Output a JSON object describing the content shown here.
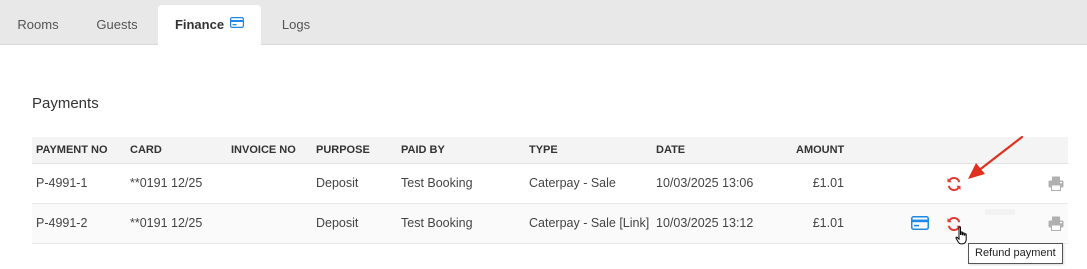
{
  "tabs": [
    {
      "label": "Rooms"
    },
    {
      "label": "Guests"
    },
    {
      "label": "Finance",
      "icon": "credit-card-icon",
      "active": true
    },
    {
      "label": "Logs"
    }
  ],
  "section": {
    "title": "Payments"
  },
  "table": {
    "headers": [
      "PAYMENT NO",
      "CARD",
      "INVOICE NO",
      "PURPOSE",
      "PAID BY",
      "TYPE",
      "DATE",
      "AMOUNT"
    ],
    "rows": [
      {
        "payment_no": "P-4991-1",
        "card": "**0191 12/25",
        "invoice_no": "",
        "purpose": "Deposit",
        "paid_by": "Test Booking",
        "type": "Caterpay - Sale",
        "date": "10/03/2025 13:06",
        "amount": "£1.01",
        "actions": [
          "refresh-icon",
          "print-icon"
        ]
      },
      {
        "payment_no": "P-4991-2",
        "card": "**0191 12/25",
        "invoice_no": "",
        "purpose": "Deposit",
        "paid_by": "Test Booking",
        "type": "Caterpay - Sale [Link]",
        "date": "10/03/2025 13:12",
        "amount": "£1.01",
        "actions": [
          "credit-card-icon",
          "refresh-icon",
          "print-icon"
        ]
      }
    ]
  },
  "tooltip": {
    "text": "Refund payment"
  },
  "colors": {
    "accent_blue": "#1e88e5",
    "refund_red": "#e53935",
    "arrow_red": "#e0301e",
    "print_gray": "#b0b0b0"
  }
}
